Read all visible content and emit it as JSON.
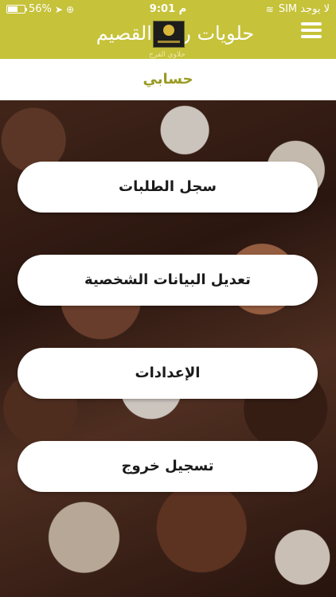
{
  "status_bar": {
    "battery_percent": "56%",
    "time": "9:01 م",
    "carrier": "لا يوجد SIM"
  },
  "header": {
    "brand_name": "حلويات ركن القصيم",
    "brand_subtitle": "حلاوي الفرح",
    "menu_icon": "hamburger-menu-icon"
  },
  "page": {
    "title": "حسابي"
  },
  "actions": [
    {
      "label": "سجل الطلبات"
    },
    {
      "label": "تعديل البيانات الشخصية"
    },
    {
      "label": "الإعدادات"
    },
    {
      "label": "تسجيل خروج"
    }
  ],
  "colors": {
    "header_bg": "#c6c23a",
    "title_text": "#9a9a23",
    "button_bg": "#ffffff"
  }
}
